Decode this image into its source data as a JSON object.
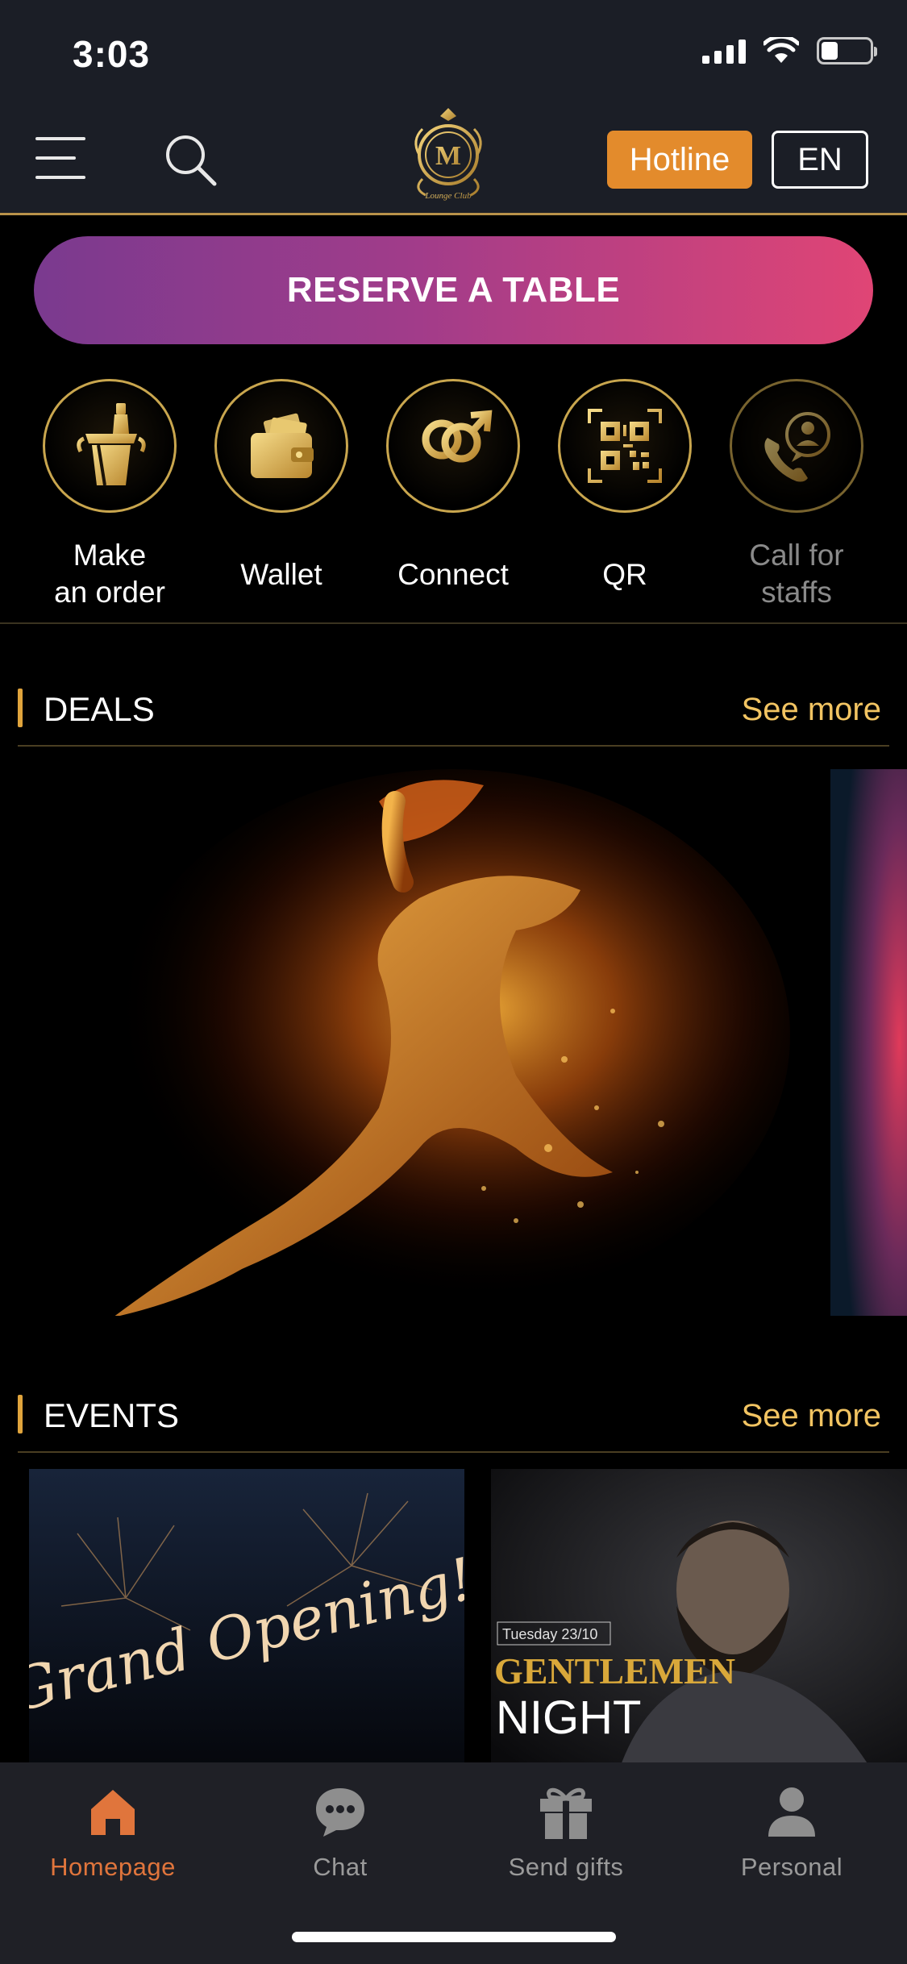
{
  "status_bar": {
    "time": "3:03",
    "battery_level": 0.35
  },
  "header": {
    "menu_icon": "hamburger-icon",
    "search_icon": "search-icon",
    "logo_monogram": "M",
    "logo_subtext": "Lounge Club",
    "hotline_label": "Hotline",
    "language_label": "EN",
    "colors": {
      "background": "#1b1e26",
      "accent": "#e38b2c",
      "gold": "#c9a64e"
    }
  },
  "reserve": {
    "label": "RESERVE A TABLE"
  },
  "quick_actions": [
    {
      "label_line1": "Make",
      "label_line2": "an order",
      "icon": "champagne-bucket-icon"
    },
    {
      "label_line1": "Wallet",
      "label_line2": "",
      "icon": "wallet-icon"
    },
    {
      "label_line1": "Connect",
      "label_line2": "",
      "icon": "gender-symbols-icon"
    },
    {
      "label_line1": "QR",
      "label_line2": "",
      "icon": "qr-code-icon"
    },
    {
      "label_line1": "Call for",
      "label_line2": "staffs",
      "icon": "call-staff-icon"
    }
  ],
  "deals": {
    "title": "DEALS",
    "see_more": "See more"
  },
  "events": {
    "title": "EVENTS",
    "see_more": "See more",
    "items": [
      {
        "title": "Grand Opening!"
      },
      {
        "date": "Tuesday 23/10",
        "title_line1": "GENTLEMEN",
        "title_line2": "NIGHT"
      }
    ]
  },
  "tabbar": {
    "tabs": [
      {
        "label": "Homepage",
        "icon": "home-icon",
        "active": true
      },
      {
        "label": "Chat",
        "icon": "chat-icon",
        "active": false
      },
      {
        "label": "Send gifts",
        "icon": "gift-icon",
        "active": false
      },
      {
        "label": "Personal",
        "icon": "person-icon",
        "active": false
      }
    ],
    "active_color": "#e0753c"
  }
}
